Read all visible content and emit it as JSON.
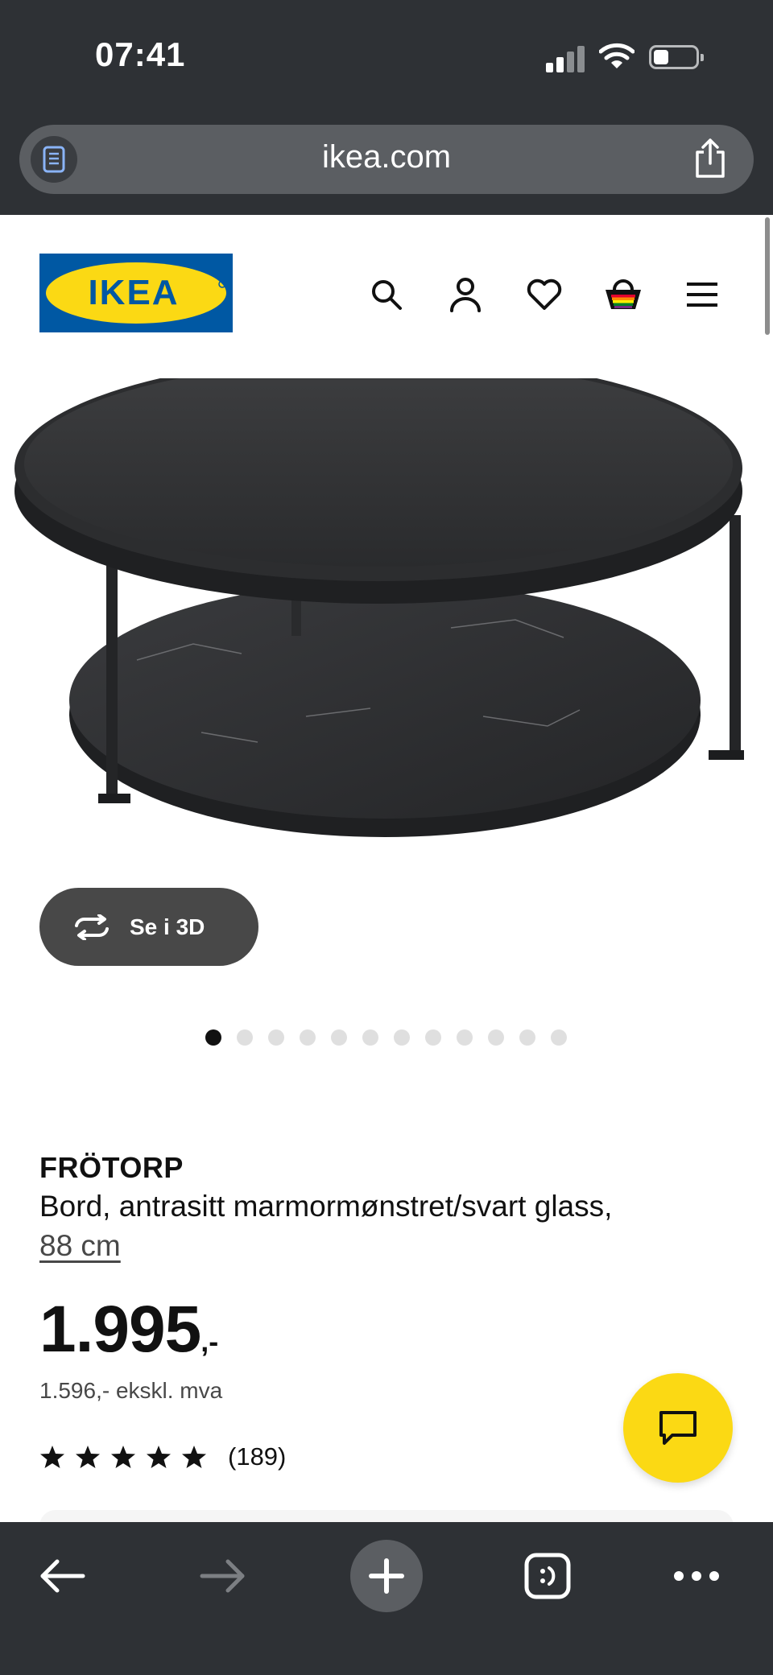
{
  "status_bar": {
    "time": "07:41"
  },
  "browser": {
    "url": "ikea.com"
  },
  "header": {
    "logo_text": "IKEA"
  },
  "product": {
    "view_3d_label": "Se i 3D",
    "carousel": {
      "total": 12,
      "active": 0
    },
    "name": "FRÖTORP",
    "description": "Bord, antrasitt marmormønstret/svart glass,",
    "size_link": "88 cm",
    "price_amount": "1.995",
    "price_suffix": ",-",
    "price_ex_vat": "1.596,- ekskl. mva",
    "rating_stars": 5,
    "rating_count": "(189)"
  },
  "colors": {
    "brand_blue": "#0058a3",
    "brand_yellow": "#fbd914",
    "chrome": "#2e3135"
  },
  "icons": [
    "reader-icon",
    "share-icon",
    "search-icon",
    "account-icon",
    "heart-icon",
    "cart-icon",
    "menu-icon",
    "rotate-3d-icon",
    "star-icon",
    "chat-icon",
    "back-icon",
    "forward-icon",
    "plus-icon",
    "tabs-icon",
    "more-icon"
  ]
}
